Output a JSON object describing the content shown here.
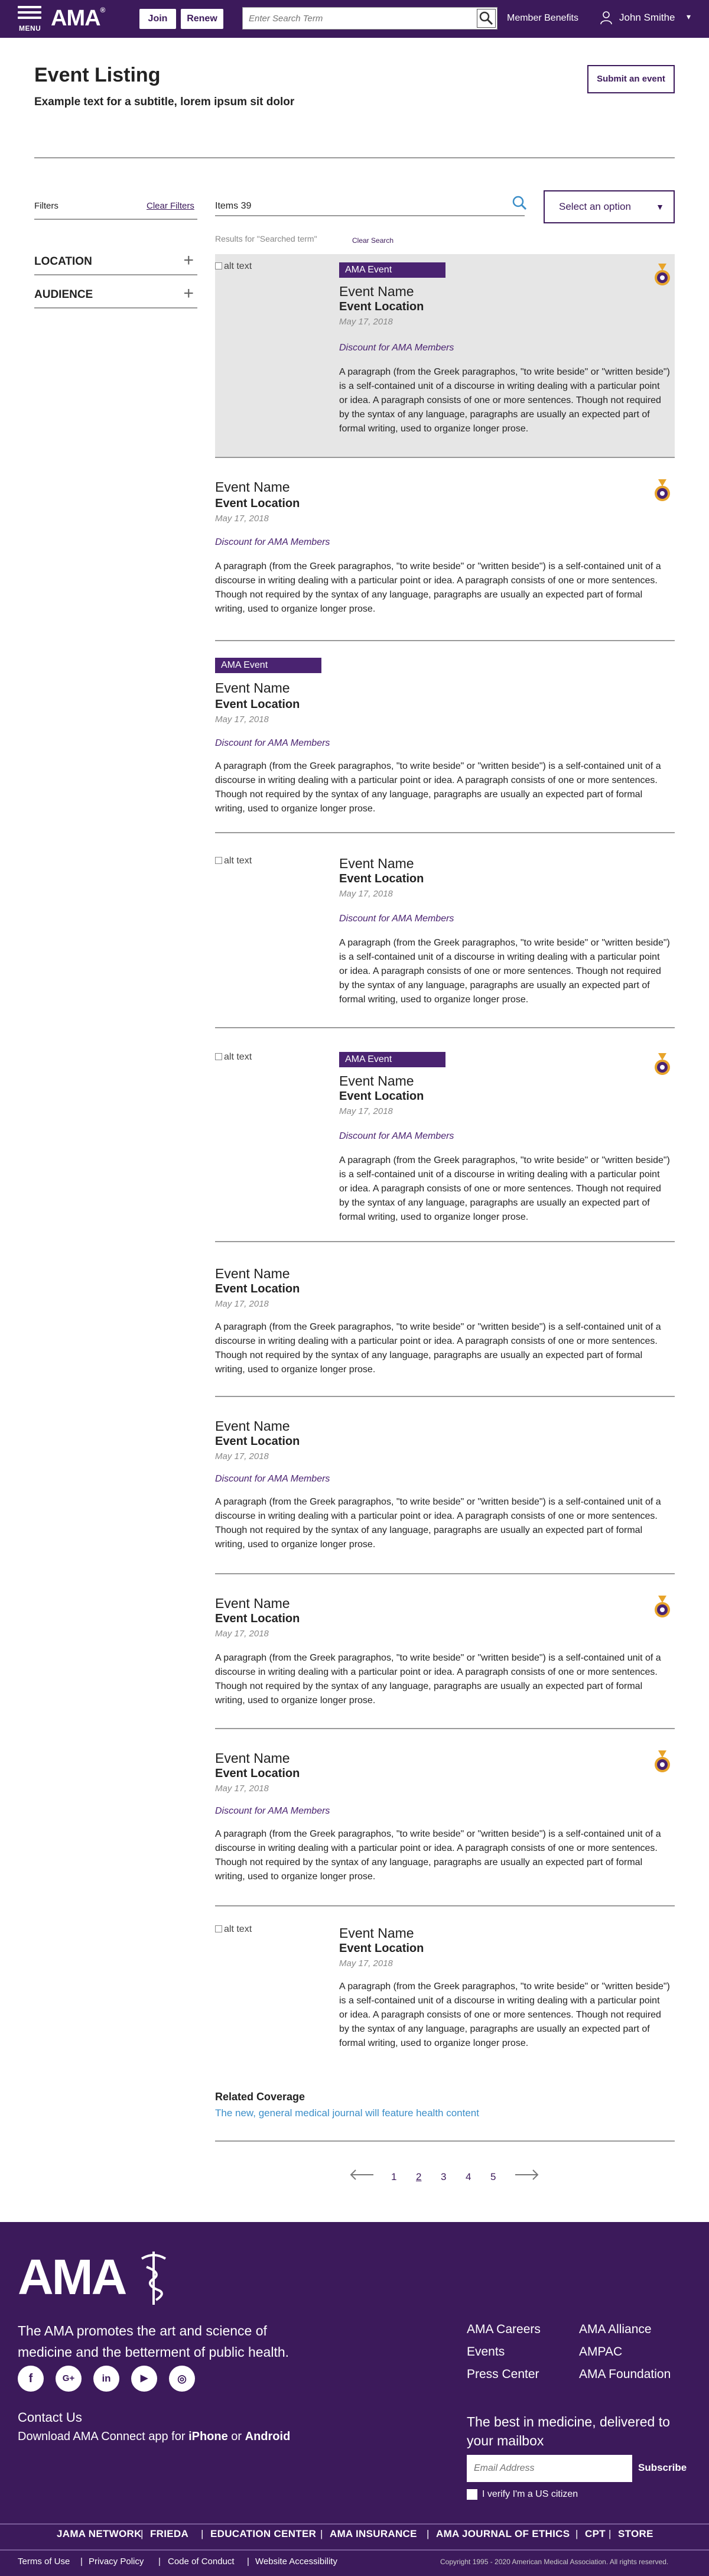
{
  "header": {
    "menu_label": "MENU",
    "logo": "AMA",
    "join": "Join",
    "renew": "Renew",
    "search_placeholder": "Enter Search Term",
    "member_benefits": "Member Benefits",
    "user_name": "John Smithe"
  },
  "page": {
    "title": "Event Listing",
    "subtitle": "Example text for a subtitle, lorem ipsum sit dolor",
    "submit_event": "Submit an event"
  },
  "filters": {
    "label": "Filters",
    "clear": "Clear Filters",
    "groups": [
      "LOCATION",
      "AUDIENCE"
    ]
  },
  "results": {
    "items": "Items 39",
    "select_placeholder": "Select an option",
    "results_for": "Results for \"Searched term\"",
    "clear_search": "Clear Search"
  },
  "common": {
    "alt": "alt text",
    "tag": "AMA Event",
    "name": "Event Name",
    "location": "Event Location",
    "date": "May 17, 2018",
    "discount": "Discount for AMA Members",
    "paragraph": "A paragraph (from the Greek paragraphos, \"to write beside\" or \"written beside\") is a self-contained unit of a discourse in writing dealing with a particular point or idea. A paragraph consists of one or more sentences. Though not required by the syntax of any language, paragraphs are usually an expected part of formal writing, used to organize longer prose."
  },
  "related": {
    "heading": "Related Coverage",
    "link": "The new, general medical journal will feature health content"
  },
  "pagination": {
    "pages": [
      "1",
      "2",
      "3",
      "4",
      "5"
    ],
    "current": "2"
  },
  "footer": {
    "logo": "AMA",
    "tagline": "The AMA promotes the art and science of medicine and the betterment of public health.",
    "contact": "Contact Us",
    "download_prefix": "Download AMA Connect app for ",
    "iphone": "iPhone",
    "or": " or ",
    "android": "Android",
    "links_col1": [
      "AMA Careers",
      "Events",
      "Press Center"
    ],
    "links_col2": [
      "AMA Alliance",
      "AMPAC",
      "AMA Foundation"
    ],
    "newsletter": "The best in medicine, delivered to your mailbox",
    "email_placeholder": "Email Address",
    "subscribe": "Subscribe",
    "verify": "I verify I'm a US citizen",
    "nav": [
      "JAMA NETWORK",
      "FRIEDA",
      "EDUCATION CENTER",
      "AMA INSURANCE",
      "AMA JOURNAL OF ETHICS",
      "CPT",
      "STORE"
    ],
    "legal": [
      "Terms of Use",
      "Privacy Policy",
      "Code of Conduct",
      "Website Accessibility"
    ],
    "copyright": "Copyright 1995 - 2020 American Medical Association. All rights reserved."
  },
  "colors": {
    "brand": "#3c1a5b",
    "link": "#3b8ec8",
    "card_highlight": "#e6e6e6"
  },
  "icons": [
    "menu-icon",
    "search-icon",
    "user-icon",
    "medal-icon",
    "plus-icon",
    "chevron-down-icon",
    "arrow-left-icon",
    "arrow-right-icon",
    "facebook-icon",
    "google-plus-icon",
    "linkedin-icon",
    "youtube-icon",
    "instagram-icon"
  ]
}
